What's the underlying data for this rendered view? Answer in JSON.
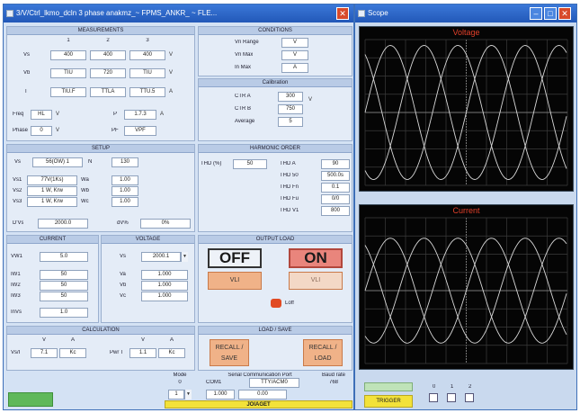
{
  "left_window": {
    "title": "3/V/Ctrl_lkmo_dcln 3 phase anakmz_~ FPMS_ANKR_ ~ FLE..."
  },
  "scope_window": {
    "title": "Scope",
    "voltage_title": "Voltage",
    "current_title": "Current"
  },
  "measurements": {
    "header": "MEASUREMENTS",
    "cols": [
      "1",
      "2",
      "3"
    ],
    "rows": [
      {
        "label": "Vs",
        "values": [
          "400",
          "400",
          "400"
        ],
        "unit": "V"
      },
      {
        "label": "Vb",
        "values": [
          "TIU",
          "720",
          "TIU"
        ],
        "unit": "V"
      },
      {
        "label": "I",
        "values": [
          "TIU.F",
          "TTLA",
          "TTU.5"
        ],
        "unit": "A"
      }
    ],
    "freq_label": "Freq",
    "freq_value": "HL",
    "freq_unit": "V",
    "phase_label": "Phase",
    "phase_value": "0",
    "phase_unit": "V",
    "p_label": "P",
    "p_value": "1.7.3",
    "p_unit": "A",
    "pf_label": "PF",
    "pf_value": "VPF"
  },
  "limits": {
    "header": "CONDITIONS",
    "rows": [
      {
        "label": "Vn Range",
        "value": "V"
      },
      {
        "label": "Vn Max",
        "value": "V"
      },
      {
        "label": "In Max",
        "value": "A"
      }
    ]
  },
  "calibration": {
    "header": "Calibration",
    "rows": [
      {
        "label": "CTR A",
        "value": "300"
      },
      {
        "label": "CTR B",
        "value": "750"
      },
      {
        "label": "Average",
        "value": "5"
      }
    ],
    "unit": "V"
  },
  "setup": {
    "header": "SETUP",
    "vs_label": "Vs",
    "vs_value": "56(OW) 1",
    "vs_b_label": "N",
    "vs_c_value": "130",
    "rows": [
      {
        "label": "Vs1",
        "value": "77V(1Ks)",
        "mid": "Wa",
        "val2": "1.00"
      },
      {
        "label": "Vs2",
        "value": "1 W, Krw",
        "mid": "Wb",
        "val2": "1.00"
      },
      {
        "label": "Vs3",
        "value": "1 W, Krw",
        "mid": "Wc",
        "val2": "1.00"
      }
    ],
    "dv_label": "D'Vs",
    "dv_value": "2000.0",
    "pct_label": "dV%",
    "pct_value": "0%"
  },
  "harmonics": {
    "header": "HARMONIC ORDER",
    "thd_label": "THD (%)",
    "thd_value": "50",
    "rows": [
      {
        "label": "THD A",
        "value": "90"
      },
      {
        "label": "THD 50",
        "value": "500.0s"
      },
      {
        "label": "THD Fn",
        "value": "0.1"
      },
      {
        "label": "THD Fu",
        "value": "0/0"
      },
      {
        "label": "THD V1",
        "value": "800"
      }
    ]
  },
  "current": {
    "header": "CURRENT",
    "rows": [
      {
        "label": "VW1",
        "value": "5.0"
      },
      {
        "label": "IW1",
        "value": "50"
      },
      {
        "label": "IW2",
        "value": "50"
      },
      {
        "label": "IW3",
        "value": "50"
      },
      {
        "label": "InVs",
        "value": "1.0"
      }
    ]
  },
  "voltage": {
    "header": "VOLTAGE",
    "vs_label": "Vs",
    "vs_value": "2000.1",
    "rows": [
      {
        "label": "Va",
        "value": "1.000"
      },
      {
        "label": "Vb",
        "value": "1.000"
      },
      {
        "label": "Vc",
        "value": "1.000"
      }
    ]
  },
  "output_control": {
    "header": "OUTPUT LOAD",
    "off_label": "OFF",
    "on_label": "ON",
    "left_btn": "VLI",
    "right_btn": "VLI",
    "led_label": "Loff"
  },
  "calc": {
    "header": "CALCULATION",
    "col1": "V",
    "col2": "A",
    "row_label": "Vs/I",
    "v1": "7.1",
    "v2": "Kc",
    "row2_label": "Pwr T",
    "v3": "1.1",
    "v4": "Kc"
  },
  "save_load": {
    "header": "LOAD / SAVE",
    "btn1": "RECALL / SAVE",
    "btn2": "RECALL / LOAD"
  },
  "bottom": {
    "mode_label": "Mode",
    "mode_value": "0",
    "port_label": "Serial Communication Port",
    "port_value": "TTY/ACM0",
    "port_left": "COM1",
    "baud_label": "Baud rate",
    "baud_value": "768",
    "status_text": "JOIAGET",
    "mode_sel": "1",
    "sel2": "1.000",
    "sel3": "0.00"
  },
  "scope_controls": {
    "labels": [
      "0",
      "1",
      "2"
    ],
    "btn_yellow": "TRIGGER"
  },
  "colors": {
    "title_blue": "#2a62c4",
    "panel_bg": "#e4ecf7",
    "off_border": "#333333",
    "on_red": "#e9857c",
    "orange_btn": "#f0b288",
    "scope_bg": "#050505",
    "trace_title": "#e2402a"
  }
}
